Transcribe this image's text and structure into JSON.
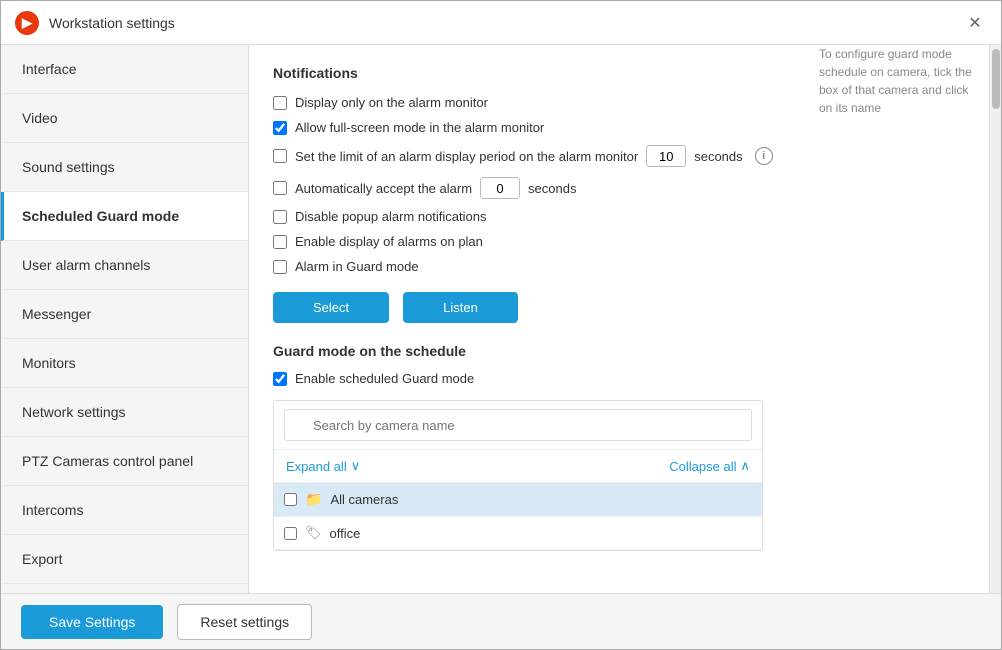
{
  "titleBar": {
    "appIconLabel": "▶",
    "title": "Workstation settings",
    "closeLabel": "✕"
  },
  "sidebar": {
    "items": [
      {
        "id": "interface",
        "label": "Interface",
        "active": false
      },
      {
        "id": "video",
        "label": "Video",
        "active": false
      },
      {
        "id": "sound-settings",
        "label": "Sound settings",
        "active": false
      },
      {
        "id": "scheduled-guard-mode",
        "label": "Scheduled Guard mode",
        "active": true
      },
      {
        "id": "user-alarm-channels",
        "label": "User alarm channels",
        "active": false
      },
      {
        "id": "messenger",
        "label": "Messenger",
        "active": false
      },
      {
        "id": "monitors",
        "label": "Monitors",
        "active": false
      },
      {
        "id": "network-settings",
        "label": "Network settings",
        "active": false
      },
      {
        "id": "ptz-cameras",
        "label": "PTZ Cameras control panel",
        "active": false
      },
      {
        "id": "intercoms",
        "label": "Intercoms",
        "active": false
      },
      {
        "id": "export",
        "label": "Export",
        "active": false
      }
    ]
  },
  "content": {
    "notificationsSection": {
      "title": "Notifications",
      "checkboxes": [
        {
          "id": "display-alarm-monitor",
          "label": "Display only on the alarm monitor",
          "checked": false
        },
        {
          "id": "fullscreen-alarm-monitor",
          "label": "Allow full-screen mode in the alarm monitor",
          "checked": true
        },
        {
          "id": "set-limit",
          "label": "Set the limit of an alarm display period on the alarm monitor",
          "checked": false
        },
        {
          "id": "auto-accept",
          "label": "Automatically accept the alarm",
          "checked": false
        },
        {
          "id": "disable-popup",
          "label": "Disable popup alarm notifications",
          "checked": false
        },
        {
          "id": "enable-display",
          "label": "Enable display of alarms on plan",
          "checked": false
        },
        {
          "id": "alarm-guard-mode",
          "label": "Alarm in Guard mode",
          "checked": false
        }
      ],
      "limitSecondsValue": "10",
      "limitSecondsLabel": "seconds",
      "acceptSecondsValue": "0",
      "acceptSecondsLabel": "seconds",
      "selectButton": "Select",
      "listenButton": "Listen"
    },
    "guardModeSection": {
      "title": "Guard mode on the schedule",
      "enableCheckbox": {
        "label": "Enable scheduled Guard mode",
        "checked": true
      },
      "searchPlaceholder": "Search by camera name",
      "expandAllLabel": "Expand all",
      "collapseAllLabel": "Collapse all",
      "cameraRows": [
        {
          "type": "folder",
          "name": "All cameras",
          "highlighted": true
        },
        {
          "type": "tag",
          "name": "office",
          "highlighted": false
        }
      ],
      "hintText": "To configure guard mode schedule on camera, tick the box of that camera and click on its name"
    }
  },
  "footer": {
    "saveLabel": "Save Settings",
    "resetLabel": "Reset settings"
  }
}
